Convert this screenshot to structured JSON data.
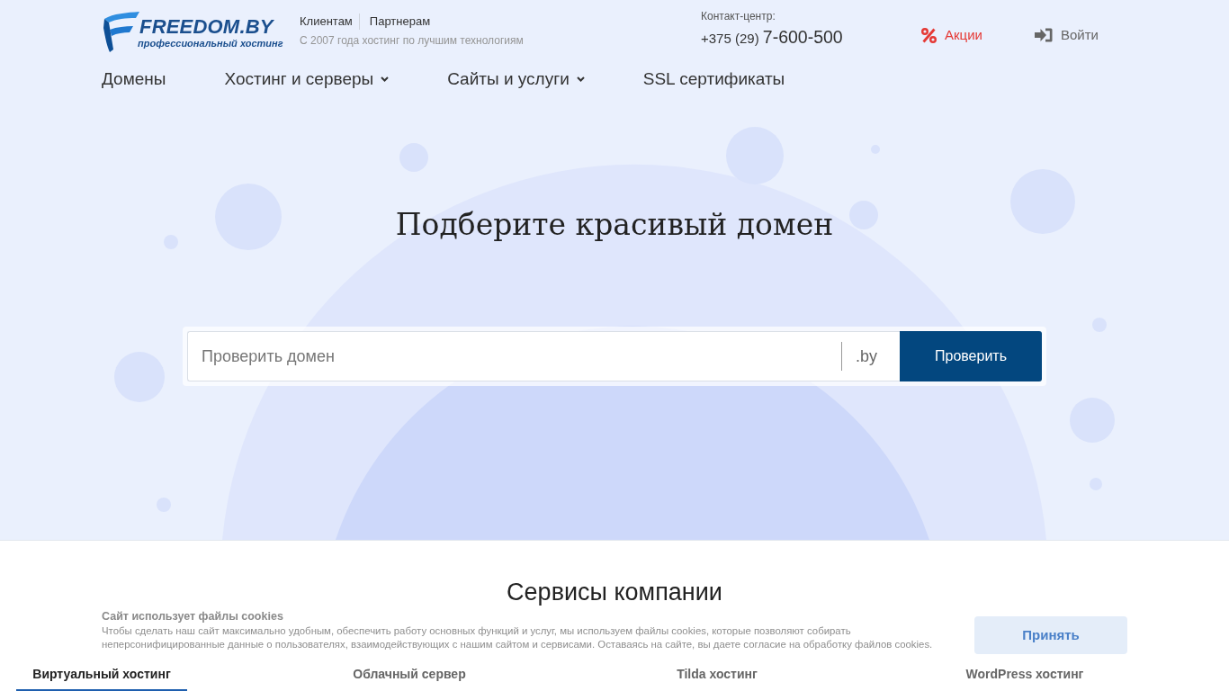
{
  "header": {
    "logo": {
      "name": "FREEDOM.BY",
      "tagline": "профессиональный хостинг"
    },
    "audience_links": [
      {
        "label": "Клиентам"
      },
      {
        "label": "Партнерам"
      }
    ],
    "slogan": "С 2007 года хостинг по лучшим технологиям",
    "contact": {
      "label": "Контакт-центр:",
      "phone_code": "+375 (29)",
      "phone_number": "7-600-500"
    },
    "promo": {
      "label": "Акции"
    },
    "login": {
      "label": "Войти"
    }
  },
  "nav": [
    {
      "label": "Домены",
      "dropdown": false
    },
    {
      "label": "Хостинг и серверы",
      "dropdown": true
    },
    {
      "label": "Сайты и услуги",
      "dropdown": true
    },
    {
      "label": "SSL сертификаты",
      "dropdown": false
    }
  ],
  "hero": {
    "title": "Подберите красивый домен",
    "search": {
      "placeholder": "Проверить домен",
      "zone": ".by",
      "button": "Проверить"
    }
  },
  "services": {
    "title": "Сервисы компании",
    "tabs": [
      {
        "label": "Виртуальный хостинг",
        "selected": true
      },
      {
        "label": "Облачный сервер",
        "selected": false
      },
      {
        "label": "Tilda хостинг",
        "selected": false
      },
      {
        "label": "WordPress хостинг",
        "selected": false
      }
    ]
  },
  "cookie_notice": {
    "title": "Сайт использует файлы cookies",
    "text": "Чтобы сделать наш сайт максимально удобным, обеспечить работу основных функций и услуг, мы используем файлы cookies, которые позволяют собирать неперсонифицированные данные о пользователях, взаимодействующих с нашим сайтом и сервисами. Оставаясь на сайте, вы даете согласие на обработку файлов cookies.",
    "button": "Принять"
  }
}
